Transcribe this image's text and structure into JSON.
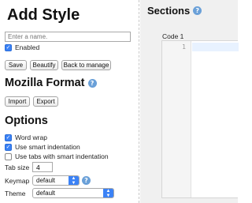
{
  "left": {
    "title": "Add Style",
    "name_placeholder": "Enter a name.",
    "enabled_label": "Enabled",
    "enabled_checked": true,
    "buttons": {
      "save": "Save",
      "beautify": "Beautify",
      "back": "Back to manage"
    },
    "mozilla_heading": "Mozilla Format",
    "import_label": "Import",
    "export_label": "Export",
    "options_heading": "Options",
    "options": [
      {
        "label": "Word wrap",
        "checked": true
      },
      {
        "label": "Use smart indentation",
        "checked": true
      },
      {
        "label": "Use tabs with smart indentation",
        "checked": false
      }
    ],
    "tab_size_label": "Tab size",
    "tab_size_value": "4",
    "keymap_label": "Keymap",
    "keymap_value": "default",
    "theme_label": "Theme",
    "theme_value": "default"
  },
  "right": {
    "title": "Sections",
    "code_label": "Code 1",
    "line_number": "1"
  },
  "icons": {
    "help": "?",
    "check": "✓",
    "up": "▲",
    "down": "▼"
  },
  "colors": {
    "accent": "#3b82f6",
    "help": "#6aa0d8",
    "panel": "#f0f0f0"
  }
}
